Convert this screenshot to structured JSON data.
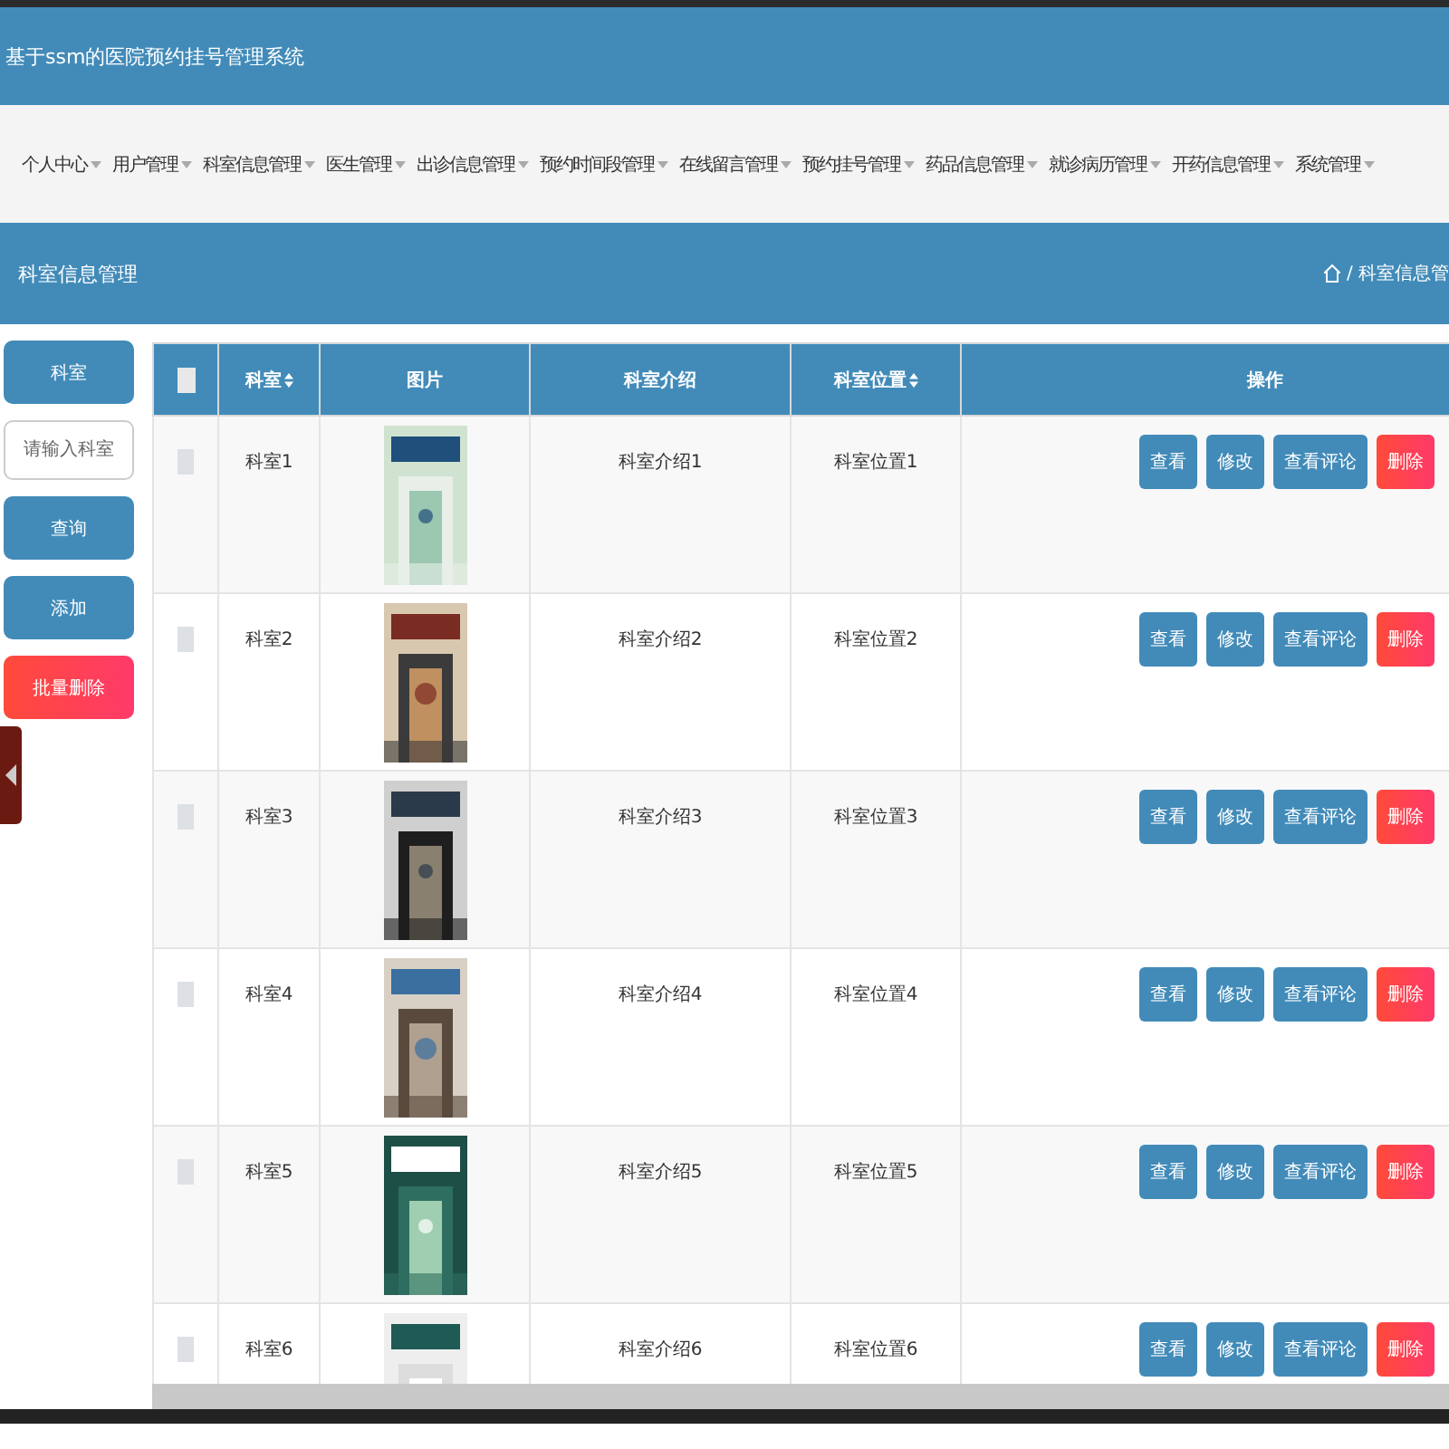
{
  "header": {
    "title": "基于ssm的医院预约挂号管理系统"
  },
  "nav": [
    {
      "label": "个人中心"
    },
    {
      "label": "用户管理"
    },
    {
      "label": "科室信息管理"
    },
    {
      "label": "医生管理"
    },
    {
      "label": "出诊信息管理"
    },
    {
      "label": "预约时间段管理"
    },
    {
      "label": "在线留言管理"
    },
    {
      "label": "预约挂号管理"
    },
    {
      "label": "药品信息管理"
    },
    {
      "label": "就诊病历管理"
    },
    {
      "label": "开药信息管理"
    },
    {
      "label": "系统管理"
    }
  ],
  "page_title": "科室信息管理",
  "breadcrumb": "/ 科室信息管",
  "sidebar": {
    "field_label": "科室",
    "search": {
      "placeholder": "请输入科室"
    },
    "buttons": [
      {
        "label": "查询",
        "kind": "primary"
      },
      {
        "label": "添加",
        "kind": "primary"
      },
      {
        "label": "批量删除",
        "kind": "danger"
      }
    ]
  },
  "table": {
    "select_all": {
      "checked": false
    },
    "columns": [
      {
        "label": "科室",
        "sortable": true
      },
      {
        "label": "图片",
        "sortable": false
      },
      {
        "label": "科室介绍",
        "sortable": false
      },
      {
        "label": "科室位置",
        "sortable": true
      },
      {
        "label": "操作",
        "sortable": false
      }
    ],
    "rows": [
      {
        "name": "科室1",
        "picture": {
          "kind": "picture"
        },
        "intro": "科室介绍1",
        "location": "科室位置1",
        "checked": false,
        "actions": [
          {
            "label": "查看",
            "kind": "primary"
          },
          {
            "label": "修改",
            "kind": "primary"
          },
          {
            "label": "查看评论",
            "kind": "primary"
          },
          {
            "label": "删除",
            "kind": "danger"
          }
        ]
      },
      {
        "name": "科室2",
        "picture": {
          "kind": "picture"
        },
        "intro": "科室介绍2",
        "location": "科室位置2",
        "checked": false,
        "actions": [
          {
            "label": "查看",
            "kind": "primary"
          },
          {
            "label": "修改",
            "kind": "primary"
          },
          {
            "label": "查看评论",
            "kind": "primary"
          },
          {
            "label": "删除",
            "kind": "danger"
          }
        ]
      },
      {
        "name": "科室3",
        "picture": {
          "kind": "picture"
        },
        "intro": "科室介绍3",
        "location": "科室位置3",
        "checked": false,
        "actions": [
          {
            "label": "查看",
            "kind": "primary"
          },
          {
            "label": "修改",
            "kind": "primary"
          },
          {
            "label": "查看评论",
            "kind": "primary"
          },
          {
            "label": "删除",
            "kind": "danger"
          }
        ]
      },
      {
        "name": "科室4",
        "picture": {
          "kind": "picture"
        },
        "intro": "科室介绍4",
        "location": "科室位置4",
        "checked": false,
        "actions": [
          {
            "label": "查看",
            "kind": "primary"
          },
          {
            "label": "修改",
            "kind": "primary"
          },
          {
            "label": "查看评论",
            "kind": "primary"
          },
          {
            "label": "删除",
            "kind": "danger"
          }
        ]
      },
      {
        "name": "科室5",
        "picture": {
          "kind": "picture"
        },
        "intro": "科室介绍5",
        "location": "科室位置5",
        "checked": false,
        "actions": [
          {
            "label": "查看",
            "kind": "primary"
          },
          {
            "label": "修改",
            "kind": "primary"
          },
          {
            "label": "查看评论",
            "kind": "primary"
          },
          {
            "label": "删除",
            "kind": "danger"
          }
        ]
      },
      {
        "name": "科室6",
        "picture": {
          "kind": "picture"
        },
        "intro": "科室介绍6",
        "location": "科室位置6",
        "checked": false,
        "actions": [
          {
            "label": "查看",
            "kind": "primary"
          },
          {
            "label": "修改",
            "kind": "primary"
          },
          {
            "label": "查看评论",
            "kind": "primary"
          },
          {
            "label": "删除",
            "kind": "danger"
          }
        ]
      }
    ]
  }
}
